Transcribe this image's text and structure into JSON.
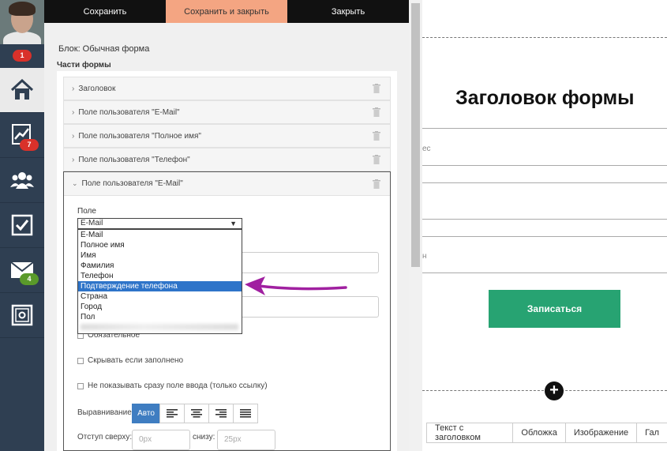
{
  "sidebar": {
    "avatar_badge": "1",
    "items": [
      {
        "icon": "home-icon"
      },
      {
        "icon": "chart-icon",
        "badge": "7"
      },
      {
        "icon": "users-icon"
      },
      {
        "icon": "checkbox-icon"
      },
      {
        "icon": "mail-icon",
        "badge": "4"
      },
      {
        "icon": "safe-icon"
      }
    ]
  },
  "toolbar": {
    "save": "Сохранить",
    "save_close": "Сохранить и закрыть",
    "close": "Закрыть"
  },
  "editor": {
    "block_title": "Блок: Обычная форма",
    "parts_title": "Части формы",
    "parts": [
      "Заголовок",
      "Поле пользователя \"E-Mail\"",
      "Поле пользователя \"Полное имя\"",
      "Поле пользователя \"Телефон\""
    ],
    "expanded_title": "Поле пользователя \"E-Mail\"",
    "field_label": "Поле",
    "field_value": "E-Mail",
    "options": [
      "E-Mail",
      "Полное имя",
      "Имя",
      "Фамилия",
      "Телефон",
      "Подтверждение телефона",
      "Страна",
      "Город",
      "Пол"
    ],
    "selected_option": "Подтверждение телефона",
    "checks": {
      "required": "Обязательное",
      "hide_filled": "Скрывать если заполнено",
      "link_only": "Не показывать сразу поле ввода (только ссылку)"
    },
    "align_label": "Выравнивание",
    "align_auto": "Авто",
    "margin_top_label": "Отступ сверху:",
    "margin_top_placeholder": "0px",
    "margin_bottom_label": "снизу:",
    "margin_bottom_placeholder": "25px"
  },
  "preview": {
    "title": "Заголовок формы",
    "label1": "ес",
    "label2": "н",
    "submit": "Записаться",
    "tabs": [
      "Текст с заголовком",
      "Обложка",
      "Изображение",
      "Гал"
    ]
  },
  "colors": {
    "sidebar_bg": "#2f3f52",
    "save_close_bg": "#f4a582",
    "selected_option": "#2e74c9",
    "submit_bg": "#27a372",
    "arrow": "#a020a0"
  }
}
